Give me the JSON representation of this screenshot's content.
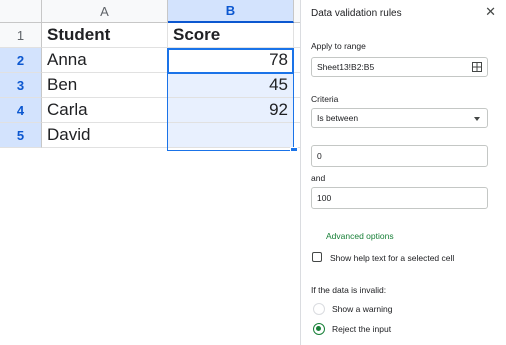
{
  "sheet": {
    "columns": [
      "A",
      "B"
    ],
    "rows": [
      {
        "num": "1",
        "a": "Student",
        "b": "Score",
        "header": true
      },
      {
        "num": "2",
        "a": "Anna",
        "b": "78"
      },
      {
        "num": "3",
        "a": "Ben",
        "b": "45"
      },
      {
        "num": "4",
        "a": "Carla",
        "b": "92"
      },
      {
        "num": "5",
        "a": "David",
        "b": ""
      }
    ],
    "selection_color": "#1a73e8"
  },
  "panel": {
    "title": "Data validation rules",
    "close_icon": "close-icon",
    "apply_to_range_label": "Apply to range",
    "range_value": "Sheet13!B2:B5",
    "criteria_label": "Criteria",
    "criteria_value": "Is between",
    "min_value": "0",
    "and_label": "and",
    "max_value": "100",
    "advanced_options": "Advanced options",
    "help_text_label": "Show help text for a selected cell",
    "invalid_label": "If the data is invalid:",
    "option_warning": "Show a warning",
    "option_reject": "Reject the input",
    "accent_color": "#188038"
  }
}
